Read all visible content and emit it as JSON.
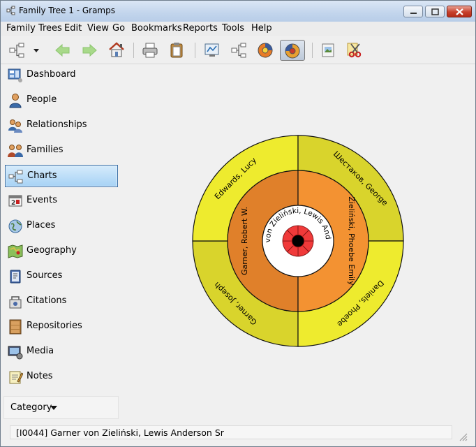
{
  "window": {
    "title": "Family Tree 1 - Gramps"
  },
  "menu": [
    {
      "label": "Family Trees"
    },
    {
      "label": "Edit"
    },
    {
      "label": "View"
    },
    {
      "label": "Go"
    },
    {
      "label": "Bookmarks"
    },
    {
      "label": "Reports"
    },
    {
      "label": "Tools"
    },
    {
      "label": "Help"
    }
  ],
  "toolbar": {
    "buttons": [
      {
        "icon": "family-trees-icon",
        "active": false
      },
      {
        "icon": "dropdown-arrow-icon",
        "active": false
      },
      {
        "icon": "back-arrow-icon",
        "active": false
      },
      {
        "icon": "forward-arrow-icon",
        "active": false
      },
      {
        "icon": "home-icon",
        "active": false
      },
      {
        "icon": "print-icon",
        "active": false
      },
      {
        "icon": "clipboard-icon",
        "active": false
      },
      {
        "icon": "pedigree-view-icon",
        "active": false
      },
      {
        "icon": "descendant-tree-icon",
        "active": false
      },
      {
        "icon": "fan-chart-icon",
        "active": false
      },
      {
        "icon": "fan-chart-active-icon",
        "active": true
      },
      {
        "icon": "media-icon",
        "active": false
      },
      {
        "icon": "scissors-icon",
        "active": false
      }
    ]
  },
  "sidebar": {
    "items": [
      {
        "label": "Dashboard",
        "icon": "dashboard-icon",
        "active": false
      },
      {
        "label": "People",
        "icon": "people-icon",
        "active": false
      },
      {
        "label": "Relationships",
        "icon": "relationships-icon",
        "active": false
      },
      {
        "label": "Families",
        "icon": "families-icon",
        "active": false
      },
      {
        "label": "Charts",
        "icon": "charts-icon",
        "active": true
      },
      {
        "label": "Events",
        "icon": "events-icon",
        "active": false
      },
      {
        "label": "Places",
        "icon": "places-icon",
        "active": false
      },
      {
        "label": "Geography",
        "icon": "geography-icon",
        "active": false
      },
      {
        "label": "Sources",
        "icon": "sources-icon",
        "active": false
      },
      {
        "label": "Citations",
        "icon": "citations-icon",
        "active": false
      },
      {
        "label": "Repositories",
        "icon": "repositories-icon",
        "active": false
      },
      {
        "label": "Media",
        "icon": "media-icon",
        "active": false
      },
      {
        "label": "Notes",
        "icon": "notes-icon",
        "active": false
      }
    ],
    "category_label": "Category"
  },
  "fan_chart": {
    "center": {
      "name": "Garner von Zieliński, Lewis Anderson Sr",
      "color": "#ffffff"
    },
    "parents": [
      {
        "name": "Garner, Robert W.",
        "color": "#e0802a"
      },
      {
        "name": "Zieliński, Phoebe Emily",
        "color": "#f39232"
      }
    ],
    "grandparents": [
      {
        "name": "Garner, Joseph",
        "color": "#d9d42c"
      },
      {
        "name": "Edwards, Lucy",
        "color": "#eeeb2e"
      },
      {
        "name": "Шестаков, George",
        "color": "#d9d42c"
      },
      {
        "name": "Daniels, Phoebe",
        "color": "#eeeb2e"
      }
    ]
  },
  "statusbar": {
    "text": "[I0044] Garner von Zieliński, Lewis Anderson Sr"
  }
}
